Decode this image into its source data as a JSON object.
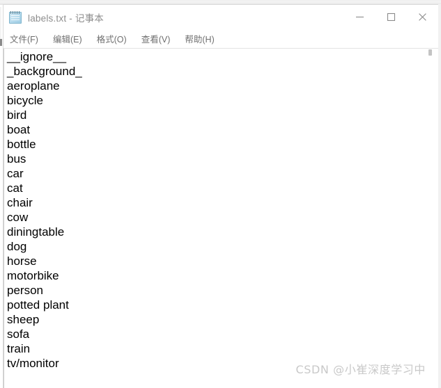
{
  "window": {
    "title": "labels.txt - 记事本",
    "icon": "notepad-icon",
    "controls": {
      "minimize_label": "—",
      "maximize_label": "□",
      "close_label": "✕"
    }
  },
  "menubar": {
    "items": [
      {
        "label": "文件(F)"
      },
      {
        "label": "编辑(E)"
      },
      {
        "label": "格式(O)"
      },
      {
        "label": "查看(V)"
      },
      {
        "label": "帮助(H)"
      }
    ]
  },
  "editor": {
    "lines": [
      "__ignore__",
      "_background_",
      "aeroplane",
      "bicycle",
      "bird",
      "boat",
      "bottle",
      "bus",
      "car",
      "cat",
      "chair",
      "cow",
      "diningtable",
      "dog",
      "horse",
      "motorbike",
      "person",
      "potted plant",
      "sheep",
      "sofa",
      "train",
      "tv/monitor"
    ]
  },
  "watermark": {
    "text": "CSDN @小崔深度学习中"
  },
  "colors": {
    "text": "#000000",
    "title_text": "#8d8d8d",
    "menu_text": "#6f6f6f",
    "watermark": "#c9c9c9",
    "window_bg": "#ffffff",
    "border": "#d9d9d9"
  }
}
